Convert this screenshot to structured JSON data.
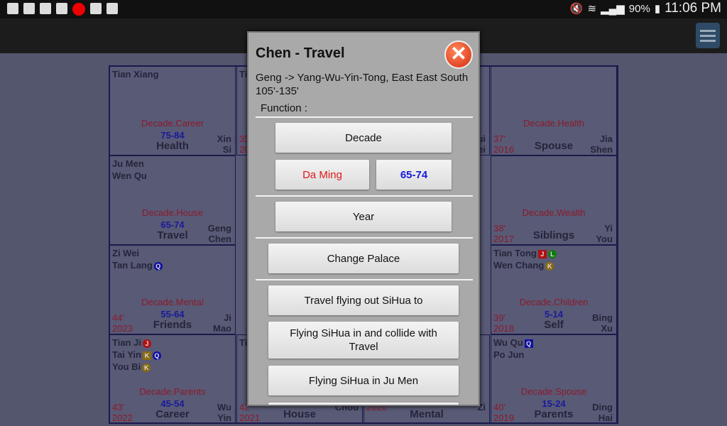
{
  "status": {
    "battery": "90%",
    "time": "11:06 PM"
  },
  "cells": [
    {
      "stars": [
        "Tian Xiang"
      ],
      "decade": "Decade.Career",
      "range": "75-84",
      "palace": "Health",
      "age": "",
      "year": "",
      "stem": "Xin",
      "branch": "Si"
    },
    {
      "stars": [
        "Ti"
      ],
      "decade": "",
      "range": "",
      "palace": "",
      "age": "35'",
      "year": "20",
      "stem": "",
      "branch": ""
    },
    {
      "stars": [],
      "decade": "",
      "range": "",
      "palace": "",
      "age": "",
      "year": "",
      "stem": "ui",
      "branch": "ei"
    },
    {
      "stars": [],
      "decade": "Decade.Health",
      "range": "",
      "palace": "Spouse",
      "age": "37'",
      "year": "2016",
      "stem": "Jia",
      "branch": "Shen"
    },
    {
      "stars": [
        "Ju Men",
        "Wen Qu"
      ],
      "decade": "Decade.House",
      "range": "65-74",
      "palace": "Travel",
      "age": "",
      "year": "",
      "stem": "Geng",
      "branch": "Chen"
    },
    {
      "stars": [],
      "decade": "Decade.Wealth",
      "range": "",
      "palace": "Siblings",
      "age": "38'",
      "year": "2017",
      "stem": "Yi",
      "branch": "You"
    },
    {
      "stars": [
        "Zi Wei",
        "Tan Lang"
      ],
      "decade": "Decade.Mental",
      "range": "55-64",
      "palace": "Friends",
      "age": "44'",
      "year": "2023",
      "stem": "Ji",
      "branch": "Mao"
    },
    {
      "stars": [
        "Tian Tong",
        "Wen Chang"
      ],
      "decade": "Decade.Children",
      "range": "5-14",
      "palace": "Self",
      "age": "39'",
      "year": "2018",
      "stem": "Bing",
      "branch": "Xu"
    },
    {
      "stars": [
        "Tian Ji",
        "Tai Yin",
        "You Bi"
      ],
      "decade": "Decade.Parents",
      "range": "45-54",
      "palace": "Career",
      "age": "43'",
      "year": "2022",
      "stem": "Wu",
      "branch": "Yin"
    },
    {
      "stars": [
        "Ti"
      ],
      "decade": "",
      "range": "",
      "palace": "House",
      "age": "42'",
      "year": "2021",
      "stem": "",
      "branch": "Chou"
    },
    {
      "stars": [],
      "decade": "",
      "range": "",
      "palace": "Mental",
      "age": "",
      "year": "2020",
      "stem": "",
      "branch": "Zi"
    },
    {
      "stars": [
        "Wu Qu",
        "Po Jun"
      ],
      "decade": "Decade.Spouse",
      "range": "15-24",
      "palace": "Parents",
      "age": "40'",
      "year": "2019",
      "stem": "Ding",
      "branch": "Hai"
    }
  ],
  "badges": {
    "J": "J",
    "K": "K",
    "L": "L",
    "Q": "Q"
  },
  "colors": {
    "J": "#b01010",
    "K": "#8a6a10",
    "L": "#107a10",
    "Q": "#1010a0"
  },
  "dialog": {
    "title": "Chen - Travel",
    "description": "Geng -> Yang-Wu-Yin-Tong, East East South 105'-135'",
    "function_label": "Function :",
    "decade": "Decade",
    "da_ming": "Da Ming",
    "range": "65-74",
    "year": "Year",
    "change_palace": "Change Palace",
    "travel_flying_out": "Travel flying out SiHua to",
    "flying_collide": "Flying SiHua in and collide with Travel",
    "flying_ju_men": "Flying SiHua in Ju Men"
  }
}
